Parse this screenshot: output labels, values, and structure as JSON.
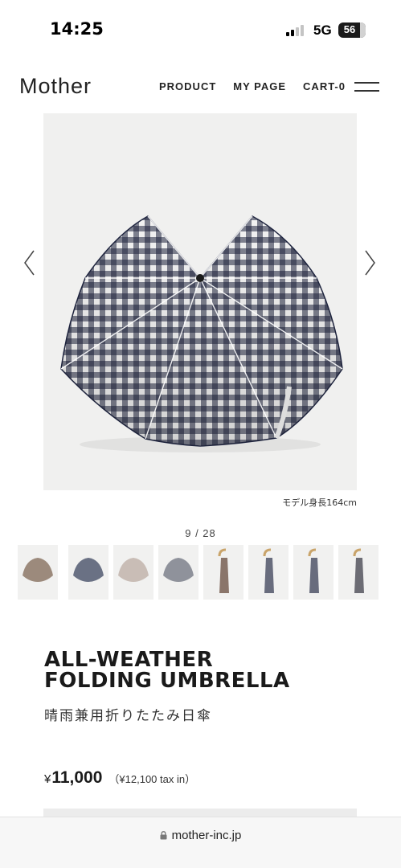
{
  "status_bar": {
    "time": "14:25",
    "network": "5G",
    "battery": "56"
  },
  "header": {
    "logo": "Mother",
    "nav": [
      {
        "label": "PRODUCT"
      },
      {
        "label": "MY PAGE"
      },
      {
        "label": "CART-0"
      }
    ]
  },
  "gallery": {
    "caption": "モデル身長164cm",
    "current": "9",
    "total": "28",
    "counter": "9 / 28",
    "thumbnails": [
      {
        "kind": "open",
        "color": "#9c8a7c"
      },
      {
        "kind": "open",
        "color": "#6a7184"
      },
      {
        "kind": "open",
        "color": "#c9bdb6"
      },
      {
        "kind": "open",
        "color": "#8f929b"
      },
      {
        "kind": "closed",
        "color": "#8a756a"
      },
      {
        "kind": "closed",
        "color": "#3a3f57"
      },
      {
        "kind": "closed",
        "color": "#3a3f57"
      },
      {
        "kind": "closed",
        "color": "#6c6c74"
      }
    ]
  },
  "product": {
    "title_line1": "ALL-WEATHER",
    "title_line2": "FOLDING UMBRELLA",
    "subtitle": "晴雨兼用折りたたみ日傘",
    "price_symbol": "¥",
    "price": "11,000",
    "price_tax": "（¥12,100 tax in）",
    "pattern_color": "#1f2540"
  },
  "browser": {
    "url": "mother-inc.jp"
  }
}
